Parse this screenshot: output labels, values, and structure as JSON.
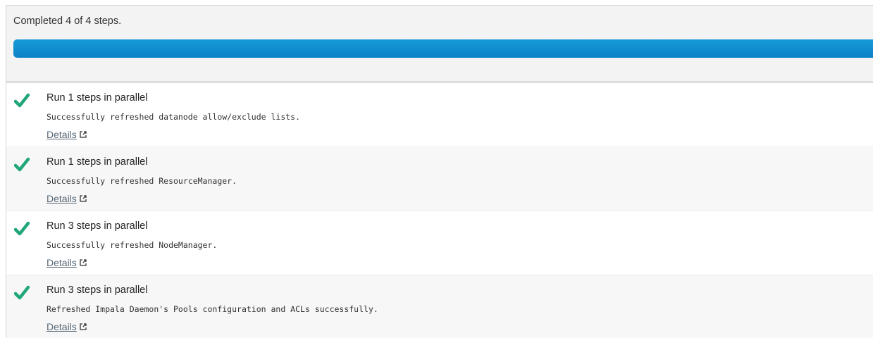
{
  "summary": {
    "text": "Completed 4 of 4 steps.",
    "progress_fraction": 1.0,
    "progress_color": "#0e88cd"
  },
  "steps": [
    {
      "status_icon": "check-icon",
      "title": "Run 1 steps in parallel",
      "message": "Successfully refreshed datanode allow/exclude lists.",
      "details_label": "Details",
      "details_icon": "external-link-icon"
    },
    {
      "status_icon": "check-icon",
      "title": "Run 1 steps in parallel",
      "message": "Successfully refreshed ResourceManager.",
      "details_label": "Details",
      "details_icon": "external-link-icon"
    },
    {
      "status_icon": "check-icon",
      "title": "Run 3 steps in parallel",
      "message": "Successfully refreshed NodeManager.",
      "details_label": "Details",
      "details_icon": "external-link-icon"
    },
    {
      "status_icon": "check-icon",
      "title": "Run 3 steps in parallel",
      "message": "Refreshed Impala Daemon's Pools configuration and ACLs successfully.",
      "details_label": "Details",
      "details_icon": "external-link-icon"
    }
  ],
  "colors": {
    "success_check": "#1fa67a",
    "link": "#5a6a78"
  }
}
